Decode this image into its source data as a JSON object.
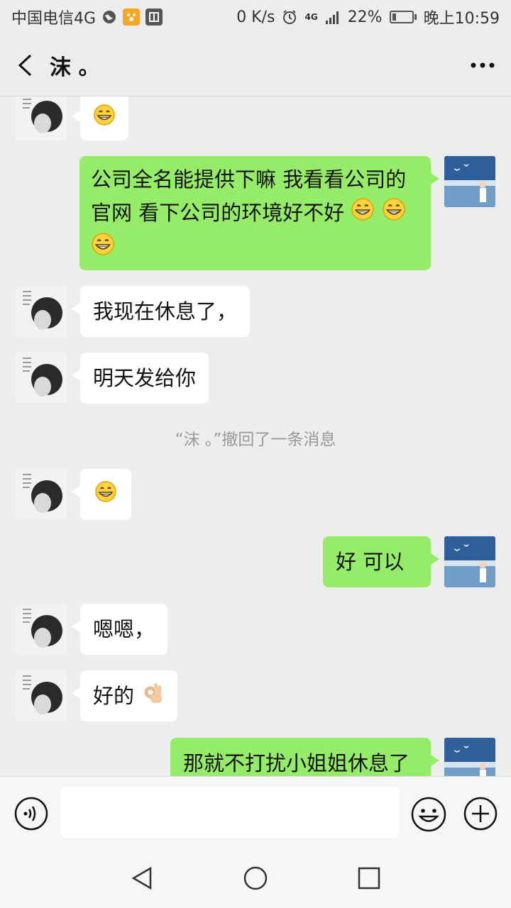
{
  "status_bar": {
    "carrier": "中国电信4G",
    "network_speed": "0 K/s",
    "signal_label": "4G",
    "battery_percent": "22%",
    "battery_level": 0.22,
    "time": "晚上10:59",
    "app_icons": [
      "globe-icon",
      "baidu-icon",
      "jd-icon"
    ]
  },
  "header": {
    "title": "沫 。",
    "back_icon": "chevron-left-icon",
    "more_icon": "more-dots-icon"
  },
  "messages": [
    {
      "side": "left",
      "text": "",
      "emojis": [
        "grin"
      ]
    },
    {
      "side": "right",
      "text": " 公司全名能提供下嘛 我看看公司的官网 看下公司的环境好不好",
      "emojis": [
        "grin",
        "grin",
        "grin"
      ]
    },
    {
      "side": "left",
      "text": "我现在休息了，",
      "emojis": []
    },
    {
      "side": "left",
      "text": "明天发给你",
      "emojis": []
    },
    {
      "side": "system",
      "text": "“沫 。”撤回了一条消息"
    },
    {
      "side": "left",
      "text": "",
      "emojis": [
        "grin"
      ]
    },
    {
      "side": "right",
      "text": "好 可以",
      "emojis": []
    },
    {
      "side": "left",
      "text": "嗯嗯，",
      "emojis": []
    },
    {
      "side": "left",
      "text": "好的",
      "emojis": [
        "ok-hand"
      ]
    },
    {
      "side": "right",
      "text": "那就不打扰小姐姐休息了",
      "emojis": []
    }
  ],
  "input_bar": {
    "voice_icon": "voice-icon",
    "input_value": "",
    "emoji_icon": "emoji-icon",
    "plus_icon": "plus-icon"
  },
  "nav_bar": {
    "back_icon": "nav-back-icon",
    "home_icon": "nav-home-icon",
    "recents_icon": "nav-recents-icon"
  },
  "colors": {
    "background": "#ededed",
    "bubble_self": "#95ec69",
    "bubble_other": "#ffffff",
    "system_text": "#9a9a9a"
  }
}
